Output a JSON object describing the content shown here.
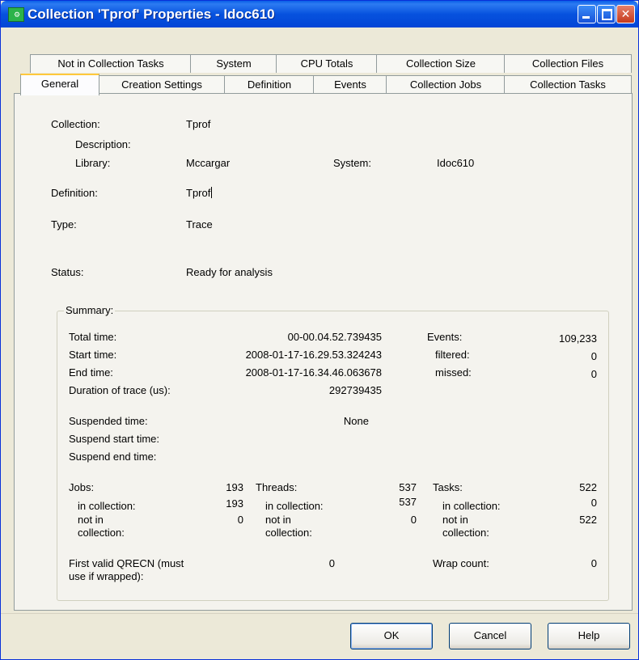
{
  "window": {
    "title": "Collection 'Tprof' Properties - Idoc610",
    "controls": {
      "minimize": "_",
      "maximize": "□",
      "close": "✕"
    }
  },
  "tabs": {
    "row_back": [
      "Not in Collection Tasks",
      "System",
      "CPU Totals",
      "Collection Size",
      "Collection Files"
    ],
    "row_front": [
      "General",
      "Creation Settings",
      "Definition",
      "Events",
      "Collection Jobs",
      "Collection Tasks"
    ],
    "selected": "General"
  },
  "general": {
    "collection_label": "Collection:",
    "collection_value": "Tprof",
    "description_label": "Description:",
    "library_label": "Library:",
    "library_value": "Mccargar",
    "system_label": "System:",
    "system_value": "Idoc610",
    "definition_label": "Definition:",
    "definition_value": "Tprof",
    "type_label": "Type:",
    "type_value": "Trace",
    "status_label": "Status:",
    "status_value": "Ready for analysis"
  },
  "summary": {
    "legend": "Summary:",
    "total_time_label": "Total time:",
    "total_time_value": "00-00.04.52.739435",
    "start_time_label": "Start time:",
    "start_time_value": "2008-01-17-16.29.53.324243",
    "end_time_label": "End time:",
    "end_time_value": "2008-01-17-16.34.46.063678",
    "duration_label": "Duration of trace (us):",
    "duration_value": "292739435",
    "events_label": "Events:",
    "events_value": "109,233",
    "filtered_label": "filtered:",
    "filtered_value": "0",
    "missed_label": "missed:",
    "missed_value": "0",
    "suspended_label": "Suspended time:",
    "suspended_value": "None",
    "suspend_start_label": "Suspend start time:",
    "suspend_end_label": "Suspend end time:",
    "jobs_label": "Jobs:",
    "jobs_value": "193",
    "jobs_in_label": "in collection:",
    "jobs_in_value": "193",
    "jobs_not_label_1": "not in",
    "jobs_not_label_2": "collection:",
    "jobs_not_value": "0",
    "threads_label": "Threads:",
    "threads_value": "537",
    "threads_in_label": "in collection:",
    "threads_in_value": "537",
    "threads_not_label_1": "not in",
    "threads_not_label_2": "collection:",
    "threads_not_value": "0",
    "tasks_label": "Tasks:",
    "tasks_value": "522",
    "tasks_in_label": "in collection:",
    "tasks_in_value": "0",
    "tasks_not_label_1": "not in",
    "tasks_not_label_2": "collection:",
    "tasks_not_value": "522",
    "qrecn_label_1": "First valid QRECN (must",
    "qrecn_label_2": "use if wrapped):",
    "qrecn_value": "0",
    "wrap_label": "Wrap count:",
    "wrap_value": "0"
  },
  "buttons": {
    "ok": "OK",
    "cancel": "Cancel",
    "help": "Help"
  }
}
